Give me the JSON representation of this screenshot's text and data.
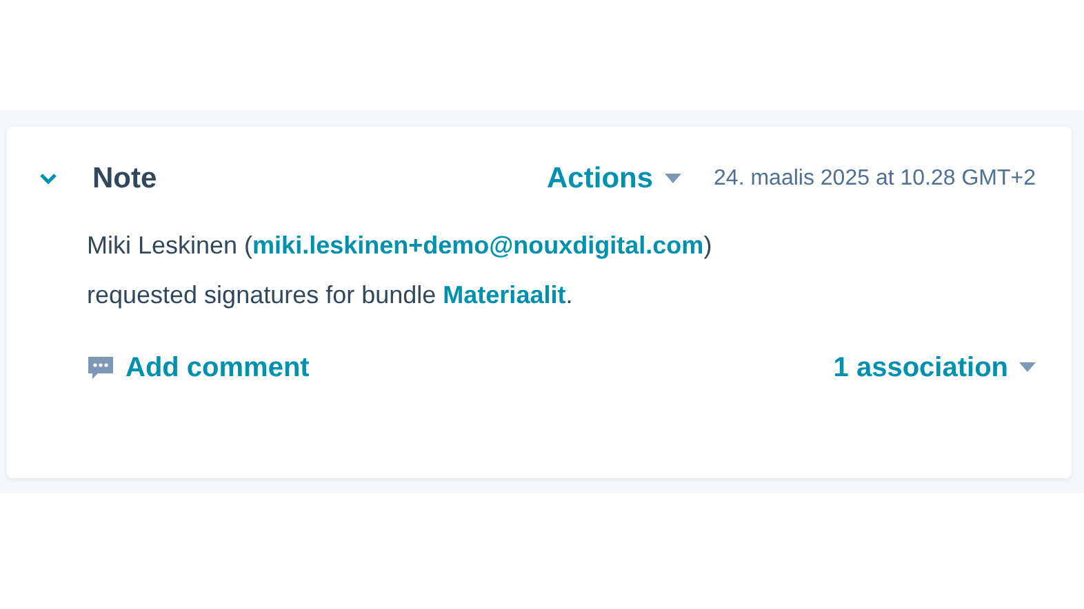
{
  "note": {
    "expanded": true,
    "title": "Note",
    "actions": "Actions",
    "timestamp": "24. maalis 2025 at 10.28 GMT+2",
    "body": [
      {
        "kind": "text",
        "text": "Miki Leskinen ("
      },
      {
        "kind": "link",
        "text": "miki.leskinen+demo@nouxdigital.com"
      },
      {
        "kind": "text",
        "text": ")"
      },
      {
        "kind": "break"
      },
      {
        "kind": "text",
        "text": "requested signatures for bundle "
      },
      {
        "kind": "link",
        "text": "Materiaalit"
      },
      {
        "kind": "text",
        "text": "."
      }
    ],
    "add_comment": "Add comment",
    "associations": "1 association"
  }
}
